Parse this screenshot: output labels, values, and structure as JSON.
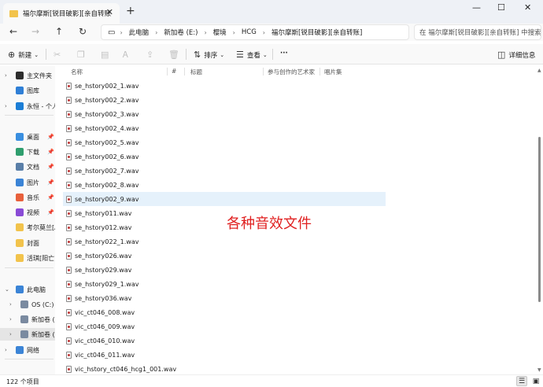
{
  "window": {
    "tab_title": "福尔摩斯[锐目破影][亲自转账]",
    "tab_close": "✕",
    "new_tab": "+",
    "minimize": "—",
    "maximize": "☐",
    "close": "✕"
  },
  "nav": {
    "back": "←",
    "forward": "→",
    "up": "↑",
    "refresh": "↻",
    "monitor_icon": "▭",
    "breadcrumbs": [
      "此电脑",
      "新加卷 (E:)",
      "樱境",
      "HCG",
      "福尔摩斯[锐目破影][亲自转账]"
    ],
    "search_placeholder": "在 福尔摩斯[锐目破影][亲自转账] 中搜索"
  },
  "toolbar": {
    "new_label": "新建",
    "sort_label": "排序",
    "view_label": "查看",
    "more_label": "···",
    "details_label": "详细信息"
  },
  "columns": {
    "name": "名称",
    "number": "#",
    "title": "标题",
    "artist": "参与创作的艺术家",
    "album": "唱片集"
  },
  "sidebar": {
    "items": [
      {
        "label": "主文件夹",
        "icon": "home-icon",
        "color": "#2d2d2d"
      },
      {
        "label": "图库",
        "icon": "gallery-icon",
        "color": "#2f7fd6"
      },
      {
        "label": "永恒 - 个人",
        "icon": "cloud-icon",
        "color": "#1c7ed6"
      },
      {
        "label": "桌面",
        "icon": "desktop-icon",
        "color": "#3a8fe0"
      },
      {
        "label": "下载",
        "icon": "download-icon",
        "color": "#2f9e6e"
      },
      {
        "label": "文档",
        "icon": "documents-icon",
        "color": "#5a7fa8"
      },
      {
        "label": "图片",
        "icon": "pictures-icon",
        "color": "#3b84d6"
      },
      {
        "label": "音乐",
        "icon": "music-icon",
        "color": "#e8603c"
      },
      {
        "label": "视频",
        "icon": "video-icon",
        "color": "#8a4bd6"
      },
      {
        "label": "考尔莫兰[Al",
        "icon": "folder-icon",
        "color": "#f2c34c"
      },
      {
        "label": "封面",
        "icon": "folder-icon",
        "color": "#f2c34c"
      },
      {
        "label": "活琪[阳亡]",
        "icon": "folder-icon",
        "color": "#f2c34c"
      },
      {
        "label": "此电脑",
        "icon": "computer-icon",
        "color": "#3b84d6"
      },
      {
        "label": "OS (C:)",
        "icon": "drive-icon",
        "color": "#7a8aa0"
      },
      {
        "label": "新加卷 (D:)",
        "icon": "drive-icon",
        "color": "#7a8aa0"
      },
      {
        "label": "新加卷 (E:)",
        "icon": "drive-icon",
        "color": "#7a8aa0"
      },
      {
        "label": "网络",
        "icon": "network-icon",
        "color": "#3b84d6"
      }
    ]
  },
  "files": [
    "se_hstory002_1.wav",
    "se_hstory002_2.wav",
    "se_hstory002_3.wav",
    "se_hstory002_4.wav",
    "se_hstory002_5.wav",
    "se_hstory002_6.wav",
    "se_hstory002_7.wav",
    "se_hstory002_8.wav",
    "se_hstory002_9.wav",
    "se_hstory011.wav",
    "se_hstory012.wav",
    "se_hstory022_1.wav",
    "se_hstory026.wav",
    "se_hstory029.wav",
    "se_hstory029_1.wav",
    "se_hstory036.wav",
    "vic_ct046_008.wav",
    "vic_ct046_009.wav",
    "vic_ct046_010.wav",
    "vic_ct046_011.wav",
    "vic_hstory_ct046_hcg1_001.wav"
  ],
  "annotation": "各种音效文件",
  "status": {
    "count": "122 个项目"
  },
  "colors": {
    "selection": "#e5f1fb",
    "annotation": "#e02020",
    "folder": "#f2c34c"
  }
}
